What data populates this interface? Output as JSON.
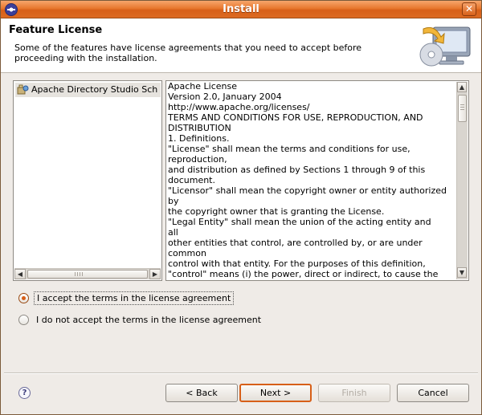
{
  "window": {
    "title": "Install",
    "close_label": "✕"
  },
  "banner": {
    "title": "Feature License",
    "description": "Some of the features have license agreements that you need to accept before proceeding with the installation."
  },
  "features": {
    "items": [
      {
        "label": "Apache Directory Studio Sch"
      }
    ]
  },
  "license": {
    "lines": [
      "Apache License",
      "Version 2.0, January 2004",
      "http://www.apache.org/licenses/",
      "TERMS AND CONDITIONS FOR USE, REPRODUCTION, AND",
      "DISTRIBUTION",
      "1. Definitions.",
      "\"License\" shall mean the terms and conditions for use,",
      "reproduction,",
      "and distribution as defined by Sections 1 through 9 of this",
      "document.",
      "\"Licensor\" shall mean the copyright owner or entity authorized",
      "by",
      "the copyright owner that is granting the License.",
      "\"Legal Entity\" shall mean the union of the acting entity and",
      "all",
      "other entities that control, are controlled by, or are under",
      "common",
      "control with that entity. For the purposes of this definition,",
      "\"control\" means (i) the power, direct or indirect, to cause the"
    ]
  },
  "options": {
    "accept": {
      "label": "I accept the terms in the license agreement",
      "selected": true
    },
    "decline": {
      "label": "I do not accept the terms in the license agreement",
      "selected": false
    }
  },
  "buttons": {
    "help": "?",
    "back": "< Back",
    "next": "Next >",
    "finish": "Finish",
    "cancel": "Cancel"
  },
  "icons": {
    "scroll_left": "◀",
    "scroll_right": "▶",
    "scroll_up": "▲",
    "scroll_down": "▼"
  },
  "colors": {
    "accent": "#d75f18",
    "titlebar": "#e8782e"
  }
}
